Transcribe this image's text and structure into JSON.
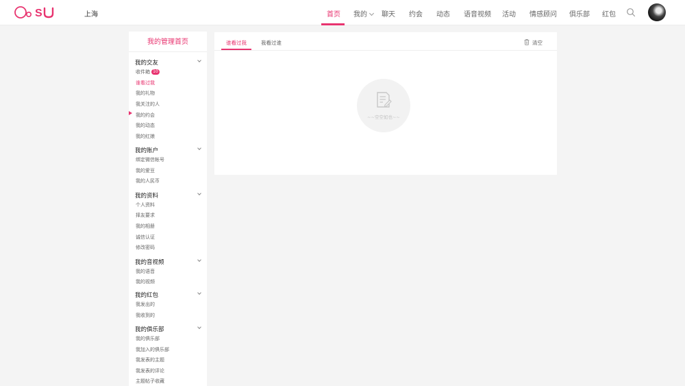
{
  "header": {
    "city": "上海",
    "nav": [
      {
        "label": "首页",
        "active": true
      },
      {
        "label": "我的",
        "dropdown": true
      },
      {
        "label": "聊天"
      },
      {
        "label": "约会"
      },
      {
        "label": "动态"
      },
      {
        "label": "语音视频"
      },
      {
        "label": "活动"
      },
      {
        "label": "情感顾问"
      },
      {
        "label": "俱乐部"
      },
      {
        "label": "红包"
      }
    ]
  },
  "sidebar": {
    "title": "我的管理首页",
    "groups": [
      {
        "title": "我的交友",
        "items": [
          {
            "label": "收件箱",
            "badge": "10"
          },
          {
            "label": "谁看过我",
            "active": true
          },
          {
            "label": "我的礼物"
          },
          {
            "label": "我关注的人"
          },
          {
            "label": "我的约会"
          },
          {
            "label": "我的动态"
          },
          {
            "label": "我的红娘"
          }
        ]
      },
      {
        "title": "我的账户",
        "items": [
          {
            "label": "绑定微信帐号"
          },
          {
            "label": "我的爱豆"
          },
          {
            "label": "我的人民币"
          }
        ]
      },
      {
        "title": "我的资料",
        "items": [
          {
            "label": "个人资料"
          },
          {
            "label": "择友要求"
          },
          {
            "label": "我的相册"
          },
          {
            "label": "诚信认证"
          },
          {
            "label": "修改密码"
          }
        ]
      },
      {
        "title": "我的音视频",
        "items": [
          {
            "label": "我的语音"
          },
          {
            "label": "我的视频"
          }
        ]
      },
      {
        "title": "我的红包",
        "items": [
          {
            "label": "我发出的"
          },
          {
            "label": "我收到的"
          }
        ]
      },
      {
        "title": "我的俱乐部",
        "items": [
          {
            "label": "我的俱乐部"
          },
          {
            "label": "我加入的俱乐部"
          },
          {
            "label": "我发表的主题"
          },
          {
            "label": "我发表的评论"
          },
          {
            "label": "主题帖子收藏"
          }
        ]
      }
    ]
  },
  "main": {
    "tabs": [
      {
        "label": "谁看过我",
        "active": true
      },
      {
        "label": "我看过谁"
      }
    ],
    "clear_label": "清空",
    "empty_text": "~~空空如也~~"
  },
  "colors": {
    "accent": "#e8336f",
    "background": "#f4f4f4"
  }
}
